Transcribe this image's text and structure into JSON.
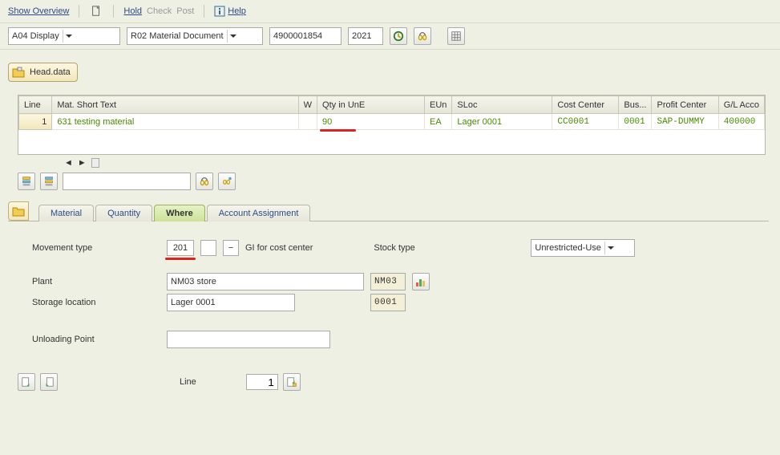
{
  "toolbar": {
    "show_overview": "Show Overview",
    "hold": "Hold",
    "check": "Check",
    "post": "Post",
    "help": "Help"
  },
  "selectors": {
    "mode": "A04 Display",
    "doc_type": "R02 Material Document",
    "doc_number": "4900001854",
    "year": "2021"
  },
  "headdata_label": "Head.data",
  "grid": {
    "headers": {
      "line": "Line",
      "mat_short": "Mat. Short Text",
      "w": "W",
      "qty": "Qty in UnE",
      "eun": "EUn",
      "sloc": "SLoc",
      "cost_center": "Cost Center",
      "bus": "Bus...",
      "profit_center": "Profit Center",
      "gl": "G/L Acco"
    },
    "row": {
      "line": "1",
      "mat_short": "631 testing material",
      "qty": "90",
      "eun": "EA",
      "sloc": "Lager 0001",
      "cost_center": "CC0001",
      "bus": "0001",
      "profit_center": "SAP-DUMMY",
      "gl": "400000"
    }
  },
  "tabs": {
    "material": "Material",
    "quantity": "Quantity",
    "where": "Where",
    "account": "Account Assignment"
  },
  "where": {
    "movement_type_label": "Movement type",
    "movement_type": "201",
    "gi_text": "GI for cost center",
    "stock_type_label": "Stock type",
    "stock_type": "Unrestricted-Use",
    "plant_label": "Plant",
    "plant_text": "NM03 store",
    "plant_code": "NM03",
    "sloc_label": "Storage location",
    "sloc_text": "Lager 0001",
    "sloc_code": "0001",
    "unloading_label": "Unloading Point"
  },
  "footer": {
    "line_label": "Line",
    "line_value": "1"
  }
}
